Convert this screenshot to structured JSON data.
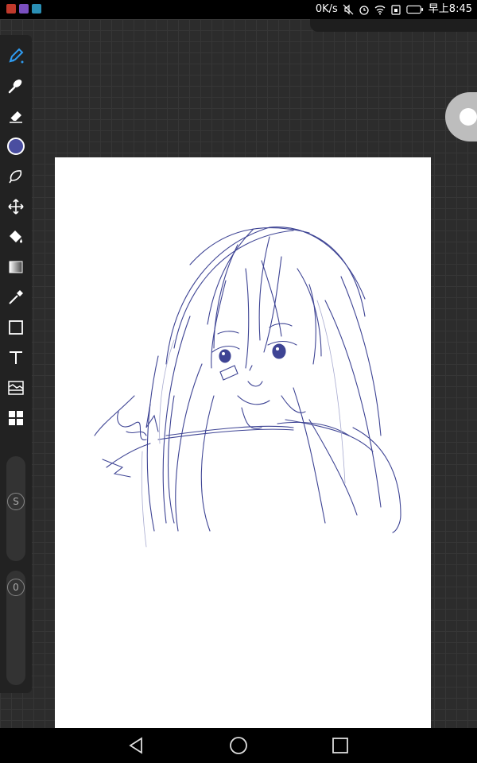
{
  "status_bar": {
    "network_speed": "0K/s",
    "time": "早上8:45",
    "icons": [
      "mute-icon",
      "alarm-icon",
      "wifi-icon",
      "sim-icon",
      "battery-icon"
    ],
    "app_icons": [
      "app-red",
      "app-purple",
      "app-teal"
    ]
  },
  "toolbar": {
    "tools": [
      {
        "name": "pen-tool",
        "icon": "pen-icon",
        "active": true
      },
      {
        "name": "smudge-tool",
        "icon": "smudge-icon"
      },
      {
        "name": "eraser-tool",
        "icon": "eraser-icon"
      },
      {
        "name": "color-picker",
        "icon": "color-swatch",
        "color": "#4a4ea0"
      },
      {
        "name": "lasso-tool",
        "icon": "lasso-icon"
      },
      {
        "name": "move-tool",
        "icon": "move-icon"
      },
      {
        "name": "fill-tool",
        "icon": "bucket-icon"
      },
      {
        "name": "gradient-tool",
        "icon": "gradient-icon"
      },
      {
        "name": "eyedropper-tool",
        "icon": "eyedropper-icon"
      },
      {
        "name": "rectangle-tool",
        "icon": "rectangle-icon"
      },
      {
        "name": "text-tool",
        "icon": "text-icon"
      },
      {
        "name": "layer-tool",
        "icon": "layers-icon"
      },
      {
        "name": "grid-tool",
        "icon": "grid-icon"
      }
    ],
    "size_slider_label": "S",
    "opacity_slider_label": "0"
  },
  "colors": {
    "ink": "#3e4494",
    "accent": "#2f9bf0",
    "workspace": "#2c2c2c"
  },
  "nav_bar": {
    "buttons": [
      "back-button",
      "home-button",
      "recents-button"
    ]
  }
}
